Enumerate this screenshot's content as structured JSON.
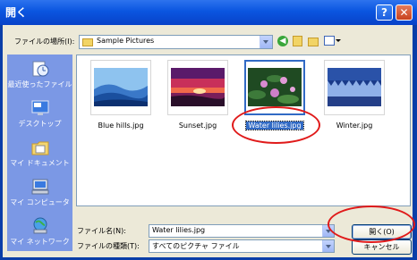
{
  "window": {
    "title": "開く",
    "help_label": "?",
    "close_label": "✕"
  },
  "lookin": {
    "label": "ファイルの場所(I):",
    "value": "Sample Pictures",
    "icon": "folder-icon"
  },
  "toolbar_icons": [
    "back-icon",
    "up-folder-icon",
    "new-folder-icon",
    "view-menu-icon"
  ],
  "places": [
    {
      "label": "最近使ったファイル",
      "icon": "recent-documents-icon"
    },
    {
      "label": "デスクトップ",
      "icon": "desktop-icon"
    },
    {
      "label": "マイ ドキュメント",
      "icon": "my-documents-icon"
    },
    {
      "label": "マイ コンピュータ",
      "icon": "my-computer-icon"
    },
    {
      "label": "マイ ネットワーク",
      "icon": "my-network-icon"
    }
  ],
  "files": [
    {
      "name": "Blue hills.jpg",
      "selected": false
    },
    {
      "name": "Sunset.jpg",
      "selected": false
    },
    {
      "name": "Water lilies.jpg",
      "selected": true
    },
    {
      "name": "Winter.jpg",
      "selected": false
    }
  ],
  "filename": {
    "label": "ファイル名(N):",
    "value": "Water lilies.jpg"
  },
  "filetype": {
    "label": "ファイルの種類(T):",
    "value": "すべてのピクチャ ファイル"
  },
  "buttons": {
    "open": "開く(O)",
    "cancel": "キャンセル"
  },
  "colors": {
    "titlebar": "#0a55e0",
    "selection": "#316ac5",
    "annotation": "#e01a1a",
    "places_bar": "#7b98e5"
  }
}
